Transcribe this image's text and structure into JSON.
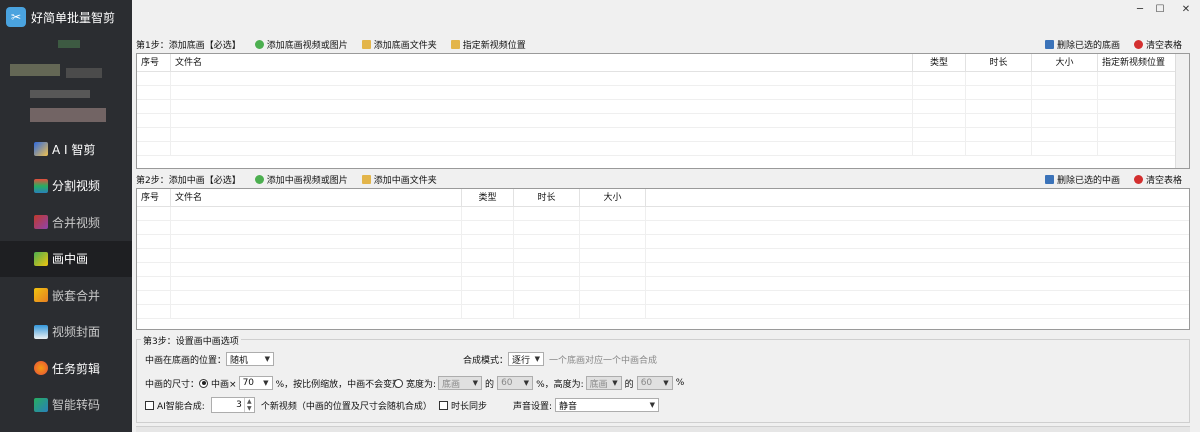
{
  "app": {
    "title": "好简单批量智剪",
    "logo_glyph": "✂"
  },
  "window": {
    "minimize": "─",
    "maximize": "☐",
    "close": "✕"
  },
  "sidebar": {
    "items": [
      {
        "label": "A I 智剪",
        "icon": "ai-icon",
        "state": "normal"
      },
      {
        "label": "分割视频",
        "icon": "split-icon",
        "state": "normal"
      },
      {
        "label": "合并视频",
        "icon": "merge-icon",
        "state": "disabled"
      },
      {
        "label": "画中画",
        "icon": "pip-icon",
        "state": "active"
      },
      {
        "label": "嵌套合并",
        "icon": "nest-icon",
        "state": "disabled"
      },
      {
        "label": "视频封面",
        "icon": "cover-icon",
        "state": "disabled"
      },
      {
        "label": "任务剪辑",
        "icon": "task-icon",
        "state": "normal"
      },
      {
        "label": "智能转码",
        "icon": "transcode-icon",
        "state": "disabled"
      }
    ]
  },
  "step1": {
    "title": "第1步：添加底画【必选】",
    "add_media": "添加底画视频或图片",
    "add_folder": "添加底画文件夹",
    "set_position": "指定新视频位置",
    "delete_selected": "删除已选的底画",
    "clear_table": "清空表格",
    "columns": [
      "序号",
      "文件名",
      "类型",
      "时长",
      "大小",
      "指定新视频位置"
    ]
  },
  "step2": {
    "title": "第2步：添加中画【必选】",
    "add_media": "添加中画视频或图片",
    "add_folder": "添加中画文件夹",
    "delete_selected": "删除已选的中画",
    "clear_table": "清空表格",
    "columns": [
      "序号",
      "文件名",
      "类型",
      "时长",
      "大小"
    ]
  },
  "step3": {
    "title": "第3步：设置画中画选项",
    "position_label": "中画在底画的位置：",
    "position_value": "随机",
    "mode_label": "合成模式：",
    "mode_value": "逐行",
    "mode_hint": "一个底画对应一个中画合成",
    "size_label": "中画的尺寸：",
    "size_option1": "中画×",
    "size_value": "70",
    "size_hint": "%，按比例缩放，中画不会变形",
    "width_label": "宽度为:",
    "width_ref": "底画",
    "of": "的",
    "width_value": "60",
    "pct_comma": "%，",
    "height_label": "高度为:",
    "height_ref": "底画",
    "height_value": "60",
    "pct": "%",
    "ai_label": "AI智能合成:",
    "ai_count": "3",
    "ai_hint": "个新视频（中画的位置及尺寸会随机合成）",
    "sync_label": "时长同步",
    "sound_label": "声音设置:",
    "sound_value": "静音"
  }
}
